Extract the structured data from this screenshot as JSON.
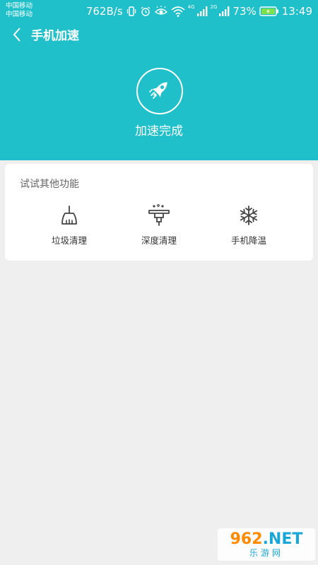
{
  "status_bar": {
    "carrier1": "中国移动",
    "carrier2": "中国移动",
    "net_speed": "762B/s",
    "net_type1": "4G",
    "net_type2": "2G",
    "battery": "73%",
    "time": "13:49",
    "icons": [
      "vibrate-icon",
      "alarm-icon",
      "eye-comfort-icon",
      "wifi-icon",
      "signal-icon",
      "signal-icon",
      "battery-charging-icon"
    ]
  },
  "nav": {
    "title": "手机加速",
    "back_icon": "chevron-left-icon"
  },
  "result": {
    "icon": "rocket-icon",
    "text": "加速完成"
  },
  "card": {
    "title": "试试其他功能",
    "features": [
      {
        "label": "垃圾清理",
        "icon": "broom-icon"
      },
      {
        "label": "深度清理",
        "icon": "deep-clean-icon"
      },
      {
        "label": "手机降温",
        "icon": "snowflake-icon"
      }
    ]
  },
  "watermark": {
    "top_digits": "962",
    "top_net": ".NET",
    "bottom": "乐游网"
  },
  "colors": {
    "header": "#1fc0c9",
    "background": "#efefef",
    "card": "#ffffff"
  }
}
